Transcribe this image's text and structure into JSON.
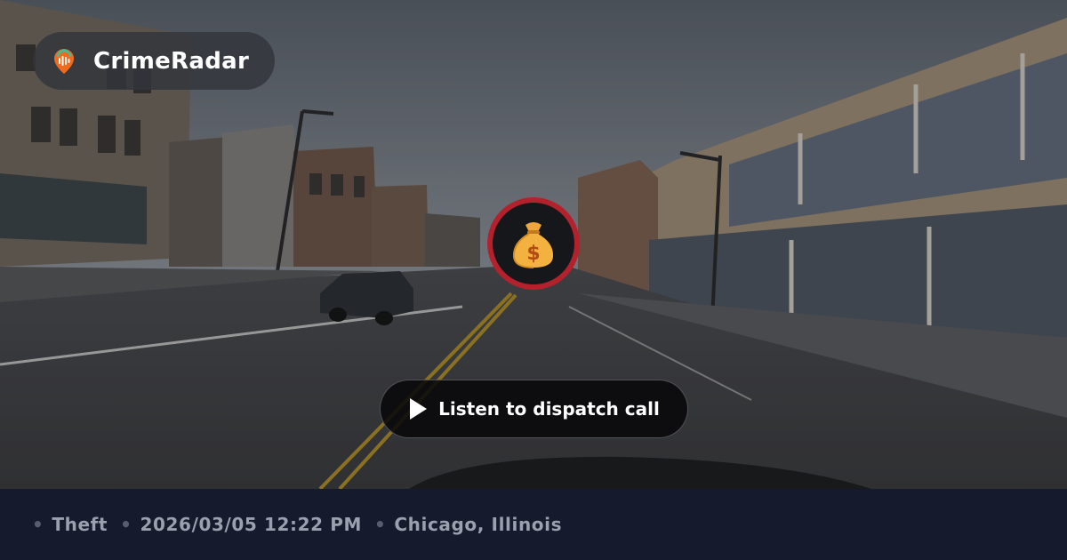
{
  "brand": {
    "name": "CrimeRadar",
    "logo_icon": "radar-pin-icon"
  },
  "incident": {
    "icon": "money-bag-icon",
    "icon_glyph": "💰",
    "ring_color": "#b3222c"
  },
  "audio": {
    "button_label": "Listen to dispatch call",
    "icon": "play-icon"
  },
  "footer": {
    "separator": "•",
    "category": "Theft",
    "datetime": "2026/03/05 12:22 PM",
    "location": "Chicago, Illinois"
  },
  "colors": {
    "footer_bg": "#151b2d",
    "meta_text": "#9aa0ad",
    "accent": "#f26b1d"
  }
}
